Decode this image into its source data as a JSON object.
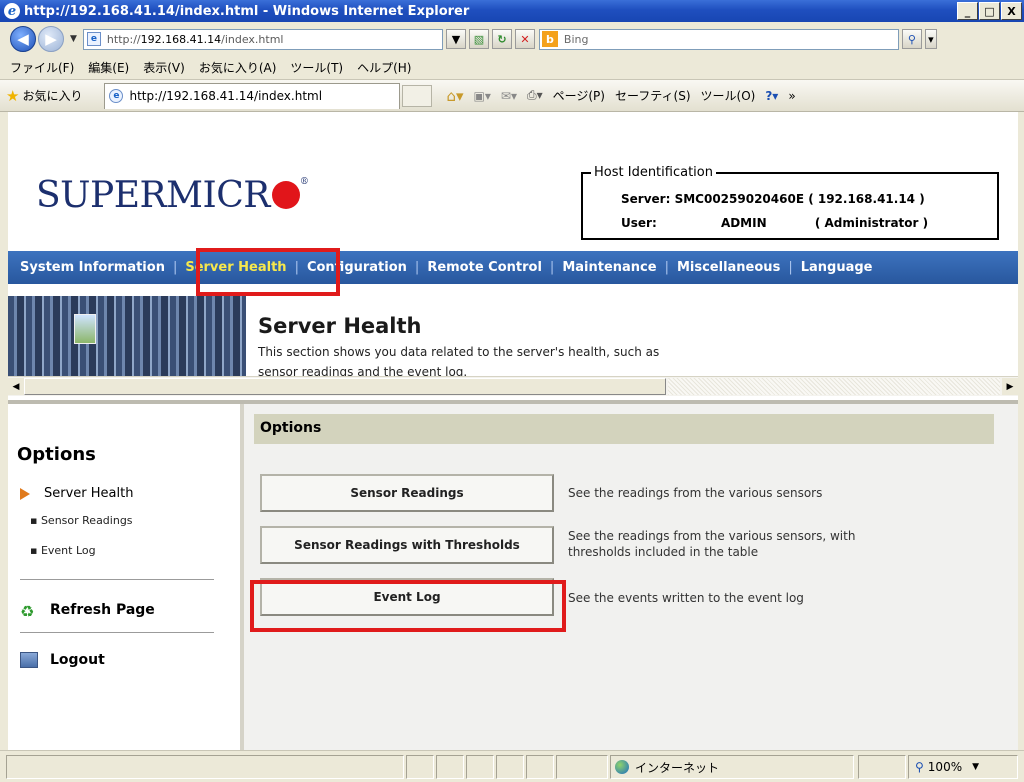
{
  "window": {
    "title": "http://192.168.41.14/index.html - Windows Internet Explorer",
    "buttons": {
      "minimize": "_",
      "maximize": "□",
      "close": "X"
    }
  },
  "address_bar": {
    "url_prefix": "http://",
    "url_host": "192.168.41.14",
    "url_path": "/index.html",
    "search_placeholder": "Bing"
  },
  "menubar": [
    "ファイル(F)",
    "編集(E)",
    "表示(V)",
    "お気に入り(A)",
    "ツール(T)",
    "ヘルプ(H)"
  ],
  "favorites_bar": {
    "favorites_label": "お気に入り",
    "tab_title": "http://192.168.41.14/index.html",
    "command_items": [
      "ページ(P)",
      "セーフティ(S)",
      "ツール(O)"
    ],
    "overflow": "»"
  },
  "header": {
    "logo_text": "SUPERMICR",
    "logo_registered": "®",
    "host_identification": {
      "legend": "Host Identification",
      "server_label": "Server:",
      "server_value": "SMC00259020460E ( 192.168.41.14 )",
      "user_label": "User:",
      "user_value": "ADMIN",
      "user_role": "( Administrator )"
    }
  },
  "main_nav": [
    "System Information",
    "Server Health",
    "Configuration",
    "Remote Control",
    "Maintenance",
    "Miscellaneous",
    "Language"
  ],
  "main_nav_active": "Server Health",
  "banner": {
    "title": "Server Health",
    "description_line1": "This section shows you data related to the server's health, such as",
    "description_line2": "sensor readings and the event log."
  },
  "sidebar": {
    "heading": "Options",
    "section": "Server Health",
    "sub_items": [
      "Sensor Readings",
      "Event Log"
    ],
    "refresh": "Refresh Page",
    "logout": "Logout"
  },
  "content": {
    "header": "Options",
    "options": [
      {
        "button": "Sensor Readings",
        "desc_line1": "See the readings from the various sensors",
        "desc_line2": ""
      },
      {
        "button": "Sensor Readings with Thresholds",
        "desc_line1": "See the readings from the various sensors, with",
        "desc_line2": "thresholds included in the table"
      },
      {
        "button": "Event Log",
        "desc_line1": "See the events written to the event log",
        "desc_line2": ""
      }
    ]
  },
  "status_bar": {
    "zone": "インターネット",
    "zoom": "100%"
  },
  "colors": {
    "nav_active": "#f7e84c",
    "highlight_box": "#e01b1b",
    "logo_blue": "#1c2f6e",
    "logo_red": "#e1151a"
  }
}
